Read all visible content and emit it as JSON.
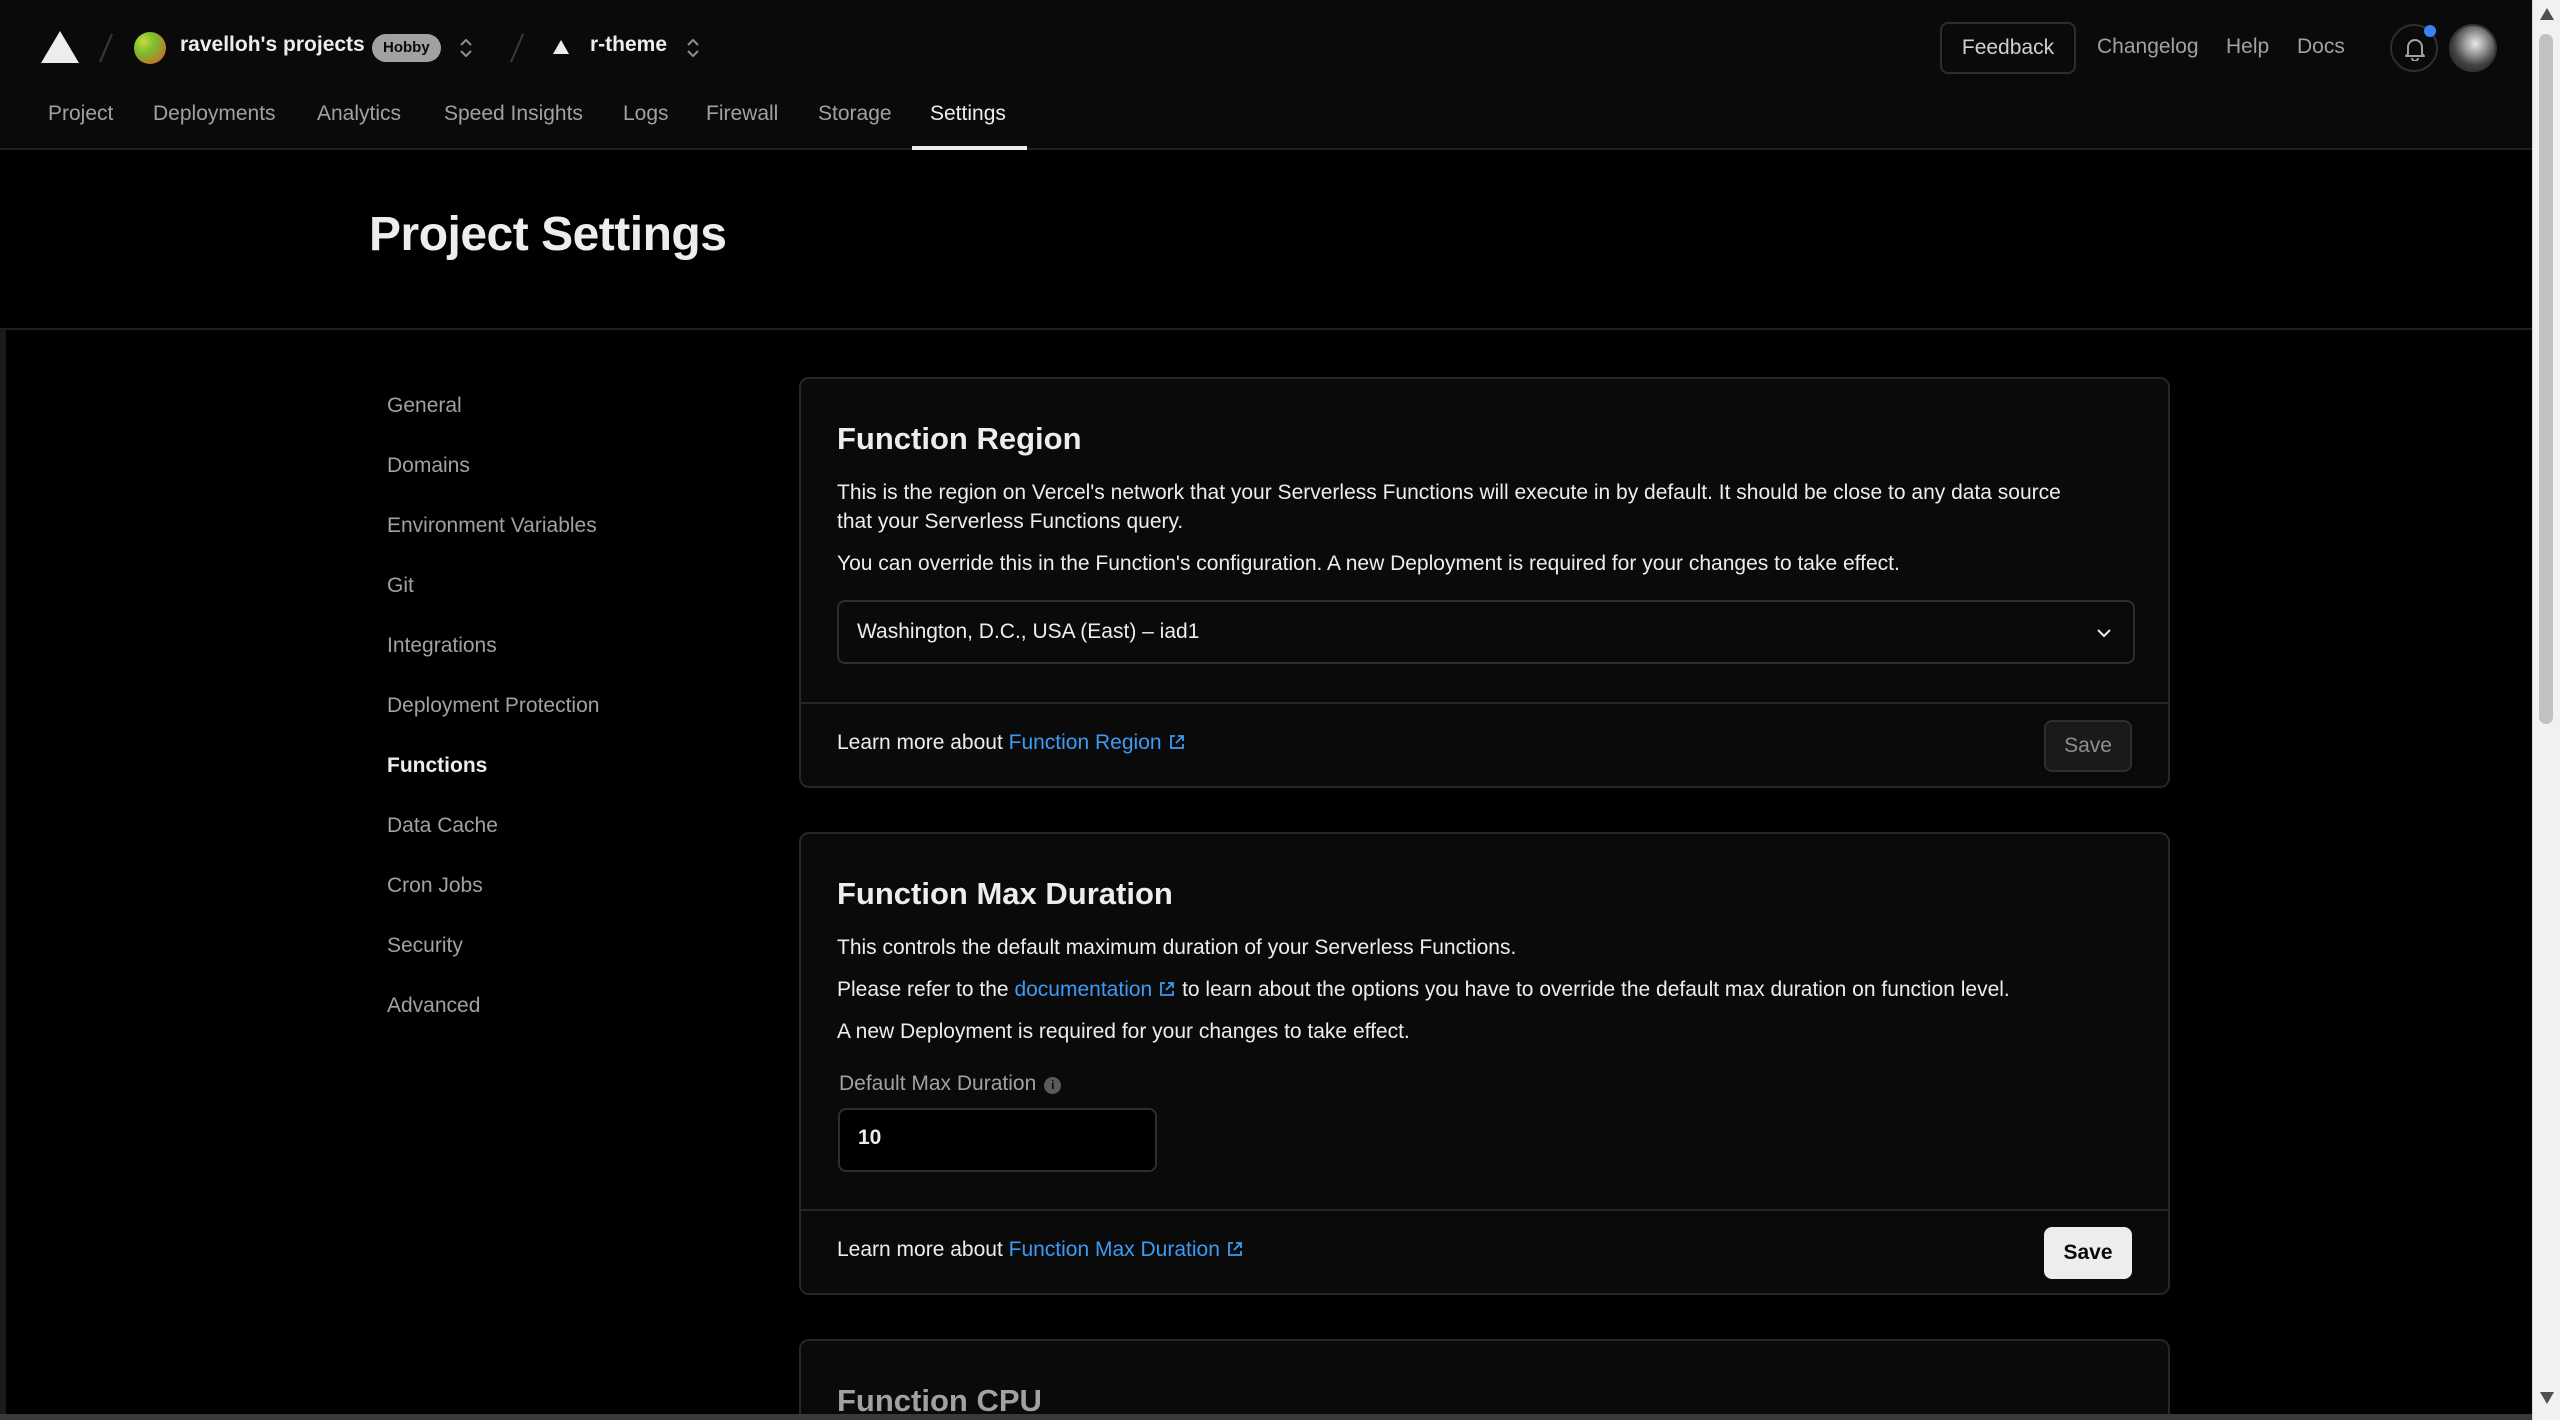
{
  "topbar": {
    "team_name": "ravelloh's projects",
    "plan_badge": "Hobby",
    "project_name": "r-theme",
    "feedback_label": "Feedback",
    "links": [
      "Changelog",
      "Help",
      "Docs"
    ],
    "notification_dot_color": "#3b82f6"
  },
  "tabs": [
    "Project",
    "Deployments",
    "Analytics",
    "Speed Insights",
    "Logs",
    "Firewall",
    "Storage",
    "Settings"
  ],
  "active_tab": "Settings",
  "page_title": "Project Settings",
  "sidebar": {
    "items": [
      "General",
      "Domains",
      "Environment Variables",
      "Git",
      "Integrations",
      "Deployment Protection",
      "Functions",
      "Data Cache",
      "Cron Jobs",
      "Security",
      "Advanced"
    ],
    "active": "Functions"
  },
  "function_region": {
    "title": "Function Region",
    "description_1a": "This is the region on Vercel's network that your Serverless Functions will execute in by default. It should be close to any data source",
    "description_1b": "that your Serverless Functions query.",
    "description_2": "You can override this in the Function's configuration. A new Deployment is required for your changes to take effect.",
    "selected_region": "Washington, D.C., USA (East) – iad1",
    "footer_prefix": "Learn more about",
    "footer_link": "Function Region",
    "save_label": "Save"
  },
  "function_max_duration": {
    "title": "Function Max Duration",
    "description_1": "This controls the default maximum duration of your Serverless Functions.",
    "description_2_prefix": "Please refer to the",
    "description_2_link": "documentation",
    "description_2_suffix": "to learn about the options you have to override the default max duration on function level.",
    "description_3": "A new Deployment is required for your changes to take effect.",
    "field_label": "Default Max Duration",
    "field_value": "10",
    "footer_prefix": "Learn more about",
    "footer_link": "Function Max Duration",
    "save_label": "Save"
  },
  "function_cpu": {
    "title": "Function CPU"
  },
  "colors": {
    "link": "#3b9bf5",
    "background": "#000000",
    "card": "#0a0a0a",
    "border": "#262626"
  }
}
